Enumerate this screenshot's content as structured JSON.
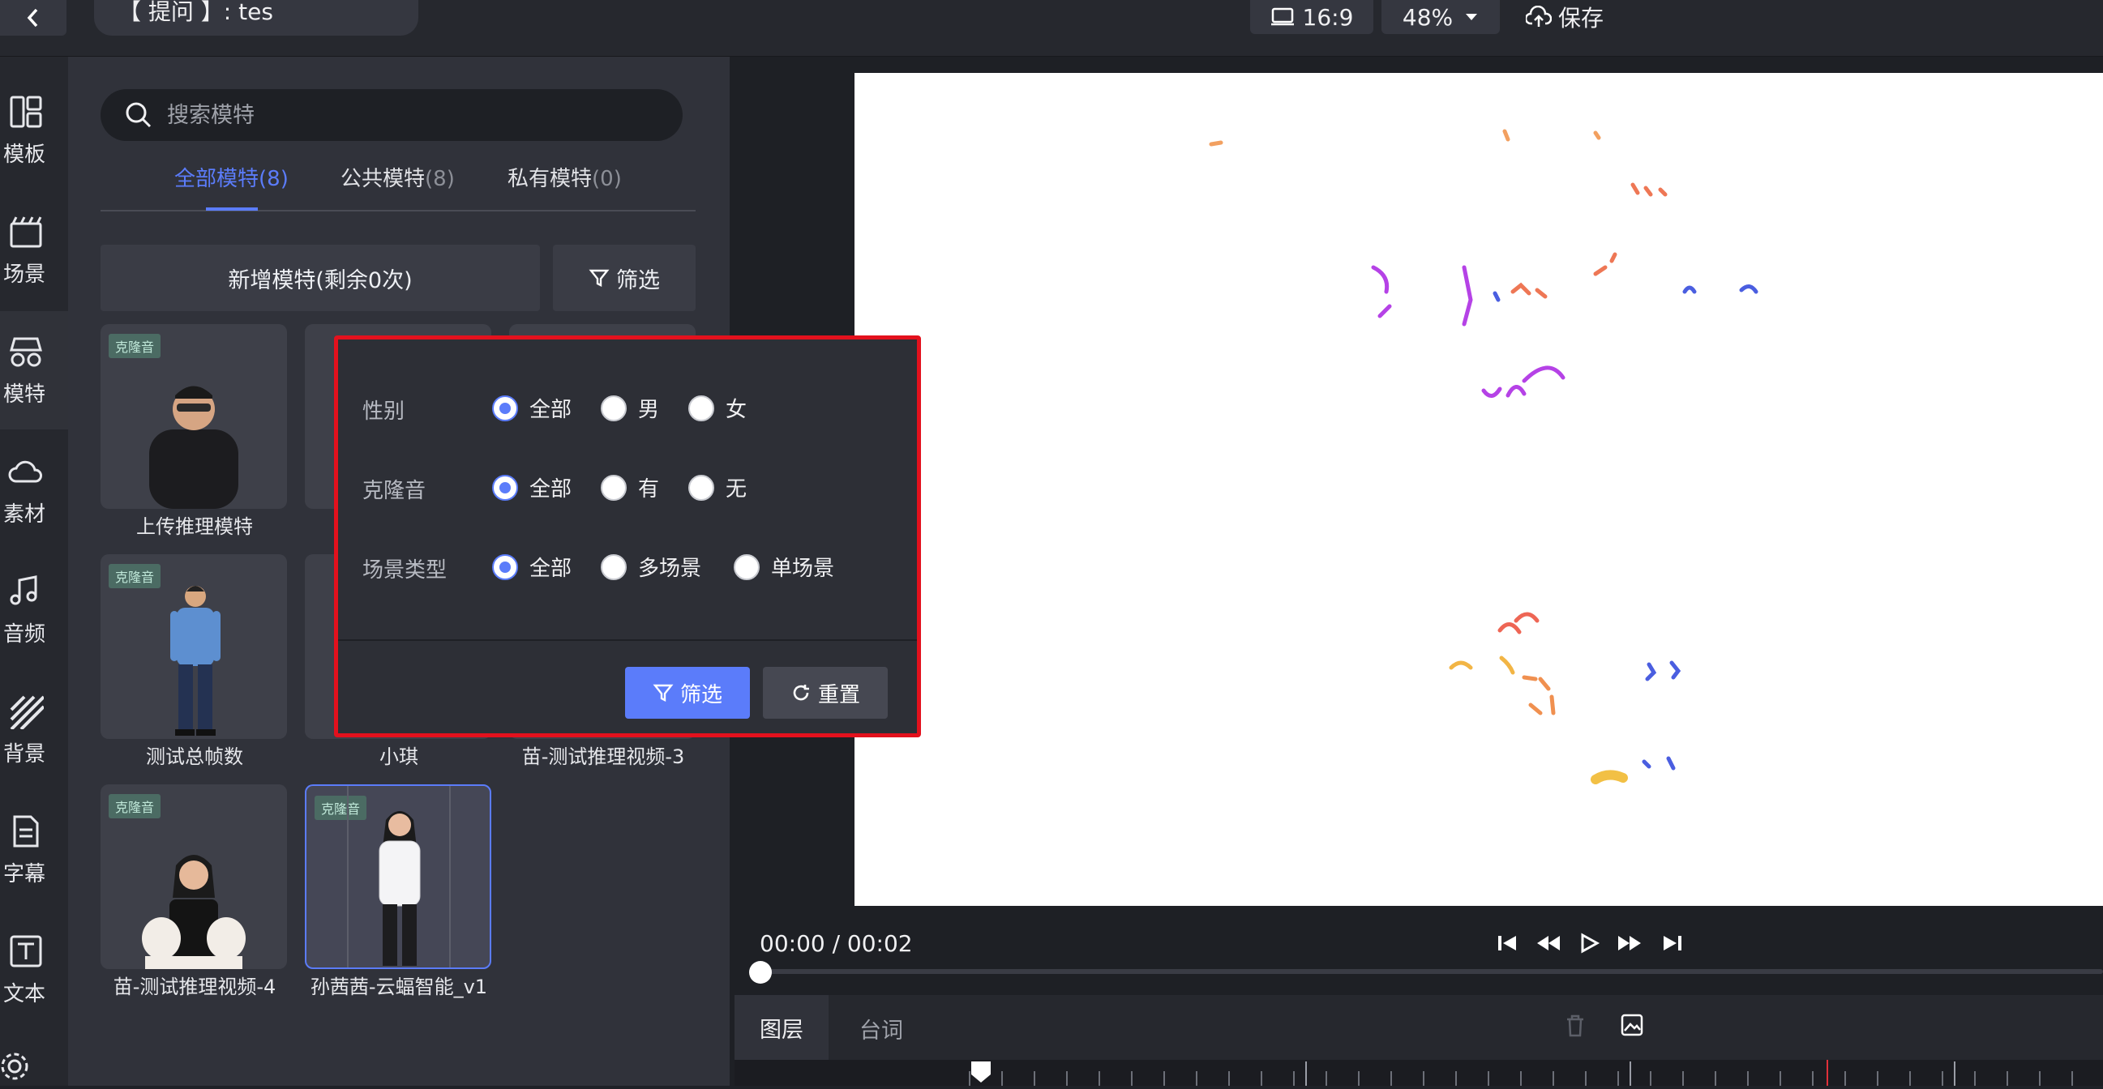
{
  "header": {
    "back_icon": "chevron-left-icon",
    "title": "【 提问 】: tes",
    "aspect_ratio": "16:9",
    "zoom": "48%",
    "save_label": "保存"
  },
  "nav": {
    "items": [
      {
        "label": "模板",
        "icon": "layout-icon"
      },
      {
        "label": "场景",
        "icon": "clapper-icon"
      },
      {
        "label": "模特",
        "icon": "model-icon"
      },
      {
        "label": "素材",
        "icon": "cloud-icon"
      },
      {
        "label": "音频",
        "icon": "music-icon"
      },
      {
        "label": "背景",
        "icon": "stripes-icon"
      },
      {
        "label": "字幕",
        "icon": "document-icon"
      },
      {
        "label": "文本",
        "icon": "text-icon"
      }
    ]
  },
  "panel": {
    "search_placeholder": "搜索模特",
    "tabs": [
      {
        "label": "全部模特",
        "count": "(8)"
      },
      {
        "label": "公共模特",
        "count": "(8)"
      },
      {
        "label": "私有模特",
        "count": "(0)"
      }
    ],
    "add_model_label": "新增模特(剩余0次)",
    "filter_label": "筛选",
    "badge_label": "克隆音",
    "cards": [
      {
        "name": "上传推理模特"
      },
      {
        "name": ""
      },
      {
        "name": ""
      },
      {
        "name": "测试总帧数"
      },
      {
        "name": "小琪"
      },
      {
        "name": "苗-测试推理视频-3"
      },
      {
        "name": "苗-测试推理视频-4"
      },
      {
        "name": "孙茜茜-云蝠智能_v1"
      }
    ]
  },
  "filter_popup": {
    "gender_label": "性别",
    "gender_options": [
      "全部",
      "男",
      "女"
    ],
    "clone_label": "克隆音",
    "clone_options": [
      "全部",
      "有",
      "无"
    ],
    "scene_label": "场景类型",
    "scene_options": [
      "全部",
      "多场景",
      "单场景"
    ],
    "apply_label": "筛选",
    "reset_label": "重置"
  },
  "player": {
    "time": "00:00 / 00:02",
    "progress": 0
  },
  "timeline": {
    "layer_tab": "图层",
    "lines_tab": "台词"
  }
}
